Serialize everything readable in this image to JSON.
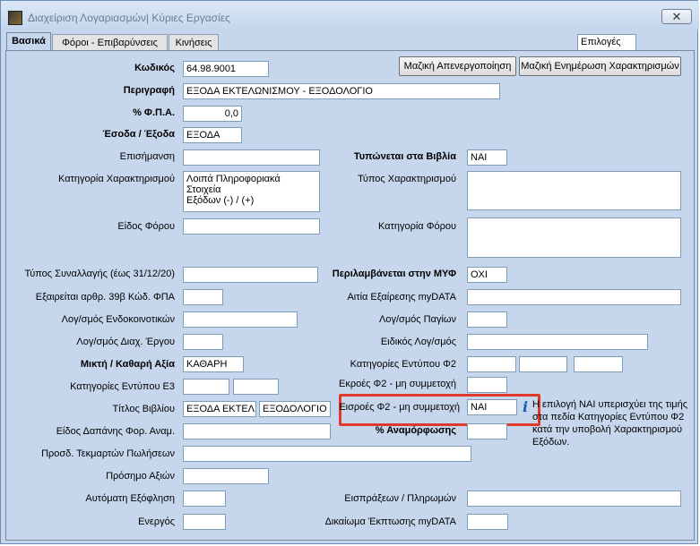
{
  "window": {
    "title": "Διαχείριση Λογαριασμών| Κύριες Εργασίες",
    "close_label": "✕"
  },
  "tabs": [
    "Βασικά",
    "Φόροι - Επιβαρύνσεις",
    "Κινήσεις"
  ],
  "options_button": "Επιλογές",
  "buttons": {
    "mass_deactivate": "Μαζική Απενεργοποίηση",
    "mass_update": "Μαζική Ενημέρωση Χαρακτηρισμών"
  },
  "fields": {
    "code": {
      "label": "Κωδικός",
      "value": "64.98.9001"
    },
    "description": {
      "label": "Περιγραφή",
      "value": "ΕΞΟΔΑ ΕΚΤΕΛΩΝΙΣΜΟΥ - ΕΞΟΔΟΛΟΓΙΟ"
    },
    "vat": {
      "label": "% Φ.Π.Α.",
      "value": "0,0"
    },
    "income_expense": {
      "label": "Έσοδα / Έξοδα",
      "value": "ΕΞΟΔΑ"
    },
    "note": {
      "label": "Επισήμανση",
      "value": ""
    },
    "printed_in_books": {
      "label": "Τυπώνεται στα Βιβλία",
      "value": "ΝΑΙ"
    },
    "classification_category": {
      "label": "Κατηγορία Χαρακτηρισμού",
      "value": "Λοιπά Πληροφοριακά Στοιχεία\nΕξόδων (-) / (+)"
    },
    "classification_type": {
      "label": "Τύπος Χαρακτηρισμού",
      "value": ""
    },
    "tax_kind": {
      "label": "Είδος Φόρου",
      "value": ""
    },
    "tax_category": {
      "label": "Κατηγορία Φόρου",
      "value": ""
    },
    "transaction_type": {
      "label": "Τύπος Συναλλαγής (έως 31/12/20)",
      "value": ""
    },
    "included_myf": {
      "label": "Περιλαμβάνεται στην ΜΥΦ",
      "value": "ΟΧΙ"
    },
    "exempt_art39b": {
      "label": "Εξαιρείται αρθρ. 39β Κώδ. ΦΠΑ",
      "value": ""
    },
    "exemption_reason": {
      "label": "Αιτία Εξαίρεσης myDATA",
      "value": ""
    },
    "intracommunity": {
      "label": "Λογ/σμός Ενδοκοινοτικών",
      "value": ""
    },
    "fixed_assets": {
      "label": "Λογ/σμός  Παγίων",
      "value": ""
    },
    "project_mgmt": {
      "label": "Λογ/σμός Διαχ. Έργου",
      "value": ""
    },
    "special_account": {
      "label": "Ειδικός Λογ/σμός",
      "value": ""
    },
    "gross_net": {
      "label": "Μικτή  / Καθαρή Αξία",
      "value": "ΚΑΘΑΡΗ"
    },
    "f2_categories": {
      "label": "Κατηγορίες Εντύπου Φ2",
      "values": [
        "",
        "",
        ""
      ]
    },
    "f2_outflows": {
      "label": "Εκροές Φ2 - μη συμμετοχή",
      "value": ""
    },
    "e3_categories": {
      "label": "Κατηγορίες Εντύπου Ε3",
      "values": [
        "",
        ""
      ]
    },
    "book_type": {
      "label": "Τίτλος Βιβλίου",
      "values": [
        "ΕΞΟΔΑ ΕΚΤΕΛ",
        "ΕΞΟΔΟΛΟΓΙΟ"
      ]
    },
    "f2_inflows": {
      "label": "Εισροές Φ2 - μη συμμετοχή",
      "value": "ΝΑΙ"
    },
    "expense_kind": {
      "label": "Είδος Δαπάνης Φορ. Αναμ.",
      "value": ""
    },
    "reverse_pct": {
      "label": "% Αναμόρφωσης",
      "value": ""
    },
    "sales_evidence": {
      "label": "Προσδ. Τεκμαρτών Πωλήσεων",
      "value": ""
    },
    "value_sign": {
      "label": "Πρόσημο Αξιών",
      "value": ""
    },
    "auto_settlement": {
      "label": "Αυτόματη Εξόφληση",
      "value": ""
    },
    "receipts_payments": {
      "label": "Εισπράξεων / Πληρωμών",
      "value": ""
    },
    "active": {
      "label": "Ενεργός",
      "value": ""
    },
    "deduction_right": {
      "label": "Δικαίωμα Έκπτωσης myDATA",
      "value": ""
    }
  },
  "info_note": "Η επιλογή ΝΑΙ υπερισχύει της τιμής στα πεδία Κατηγορίες Εντύπου Φ2 κατά την υποβολή Χαρακτηρισμού Εξόδων.",
  "colors": {
    "highlight": "#e0392b",
    "background": "#c6d6ec"
  }
}
